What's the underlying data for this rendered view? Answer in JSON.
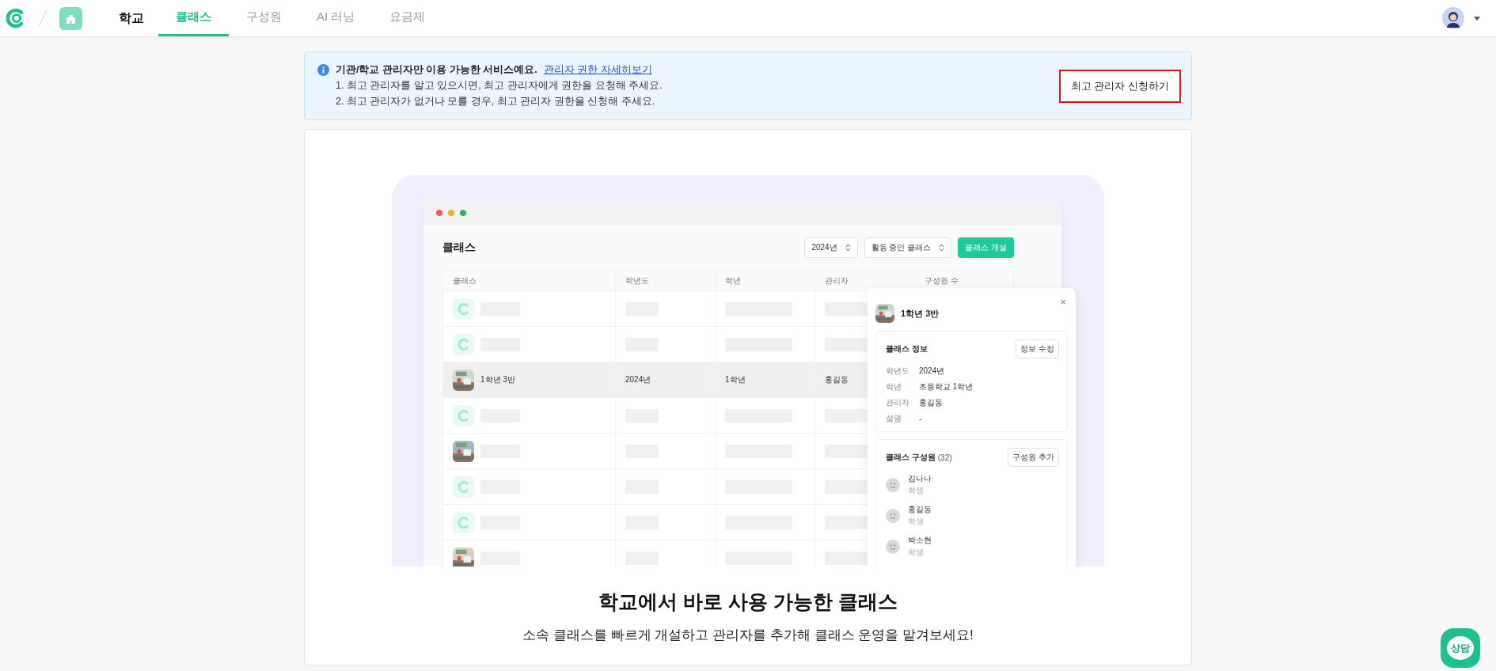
{
  "nav": {
    "school_name": "학교",
    "tabs": [
      {
        "label": "클래스",
        "selected": true
      },
      {
        "label": "구성원",
        "selected": false
      },
      {
        "label": "AI 러닝",
        "selected": false
      },
      {
        "label": "요금제",
        "selected": false
      }
    ]
  },
  "notice": {
    "title": "기관/학교 관리자만 이용 가능한 서비스예요.",
    "link": "관리자 권한 자세히보기",
    "steps": [
      "1. 최고 관리자를 알고 있으시면, 최고 관리자에게 권한을 요청해 주세요.",
      "2. 최고 관리자가 없거나 모를 경우, 최고 관리자 권한을 신청해 주세요."
    ],
    "button": "최고 관리자 신청하기"
  },
  "illustration": {
    "window": {
      "title": "클래스",
      "year_select": "2024년",
      "status_select": "활동 중인 클래스",
      "create_button": "클래스 개설",
      "columns": [
        "클래스",
        "학년도",
        "학년",
        "관리자",
        "구성원 수"
      ],
      "rows": [
        {
          "kind": "logo",
          "selected": false
        },
        {
          "kind": "logo",
          "selected": false
        },
        {
          "kind": "picture",
          "selected": true,
          "cells": [
            "1학년 3반",
            "2024년",
            "1학년",
            "홍길동"
          ]
        },
        {
          "kind": "logo",
          "selected": false
        },
        {
          "kind": "picture",
          "selected": false
        },
        {
          "kind": "logo",
          "selected": false
        },
        {
          "kind": "logo",
          "selected": false
        },
        {
          "kind": "picture",
          "selected": false
        }
      ]
    },
    "panel": {
      "title": "1학년 3반",
      "close": "×",
      "info": {
        "title": "클래스 정보",
        "button": "정보 수정",
        "fields": [
          {
            "label": "학년도",
            "value": "2024년"
          },
          {
            "label": "학년",
            "value": "초등학교 1학년"
          },
          {
            "label": "관리자",
            "value": "홍길동"
          },
          {
            "label": "설명",
            "value": "-"
          }
        ]
      },
      "members": {
        "title": "클래스 구성원",
        "count": "(32)",
        "button": "구성원 추가",
        "items": [
          {
            "name": "김나나",
            "role": "학생"
          },
          {
            "name": "홍길동",
            "role": "학생"
          },
          {
            "name": "박소현",
            "role": "학생"
          }
        ]
      }
    }
  },
  "heading": "학교에서 바로 사용 가능한 클래스",
  "subtitle": "소속 클래스를 빠르게 개설하고 관리자를 추가해 클래스 운영을 맡겨보세요!",
  "chat_button": "상담"
}
